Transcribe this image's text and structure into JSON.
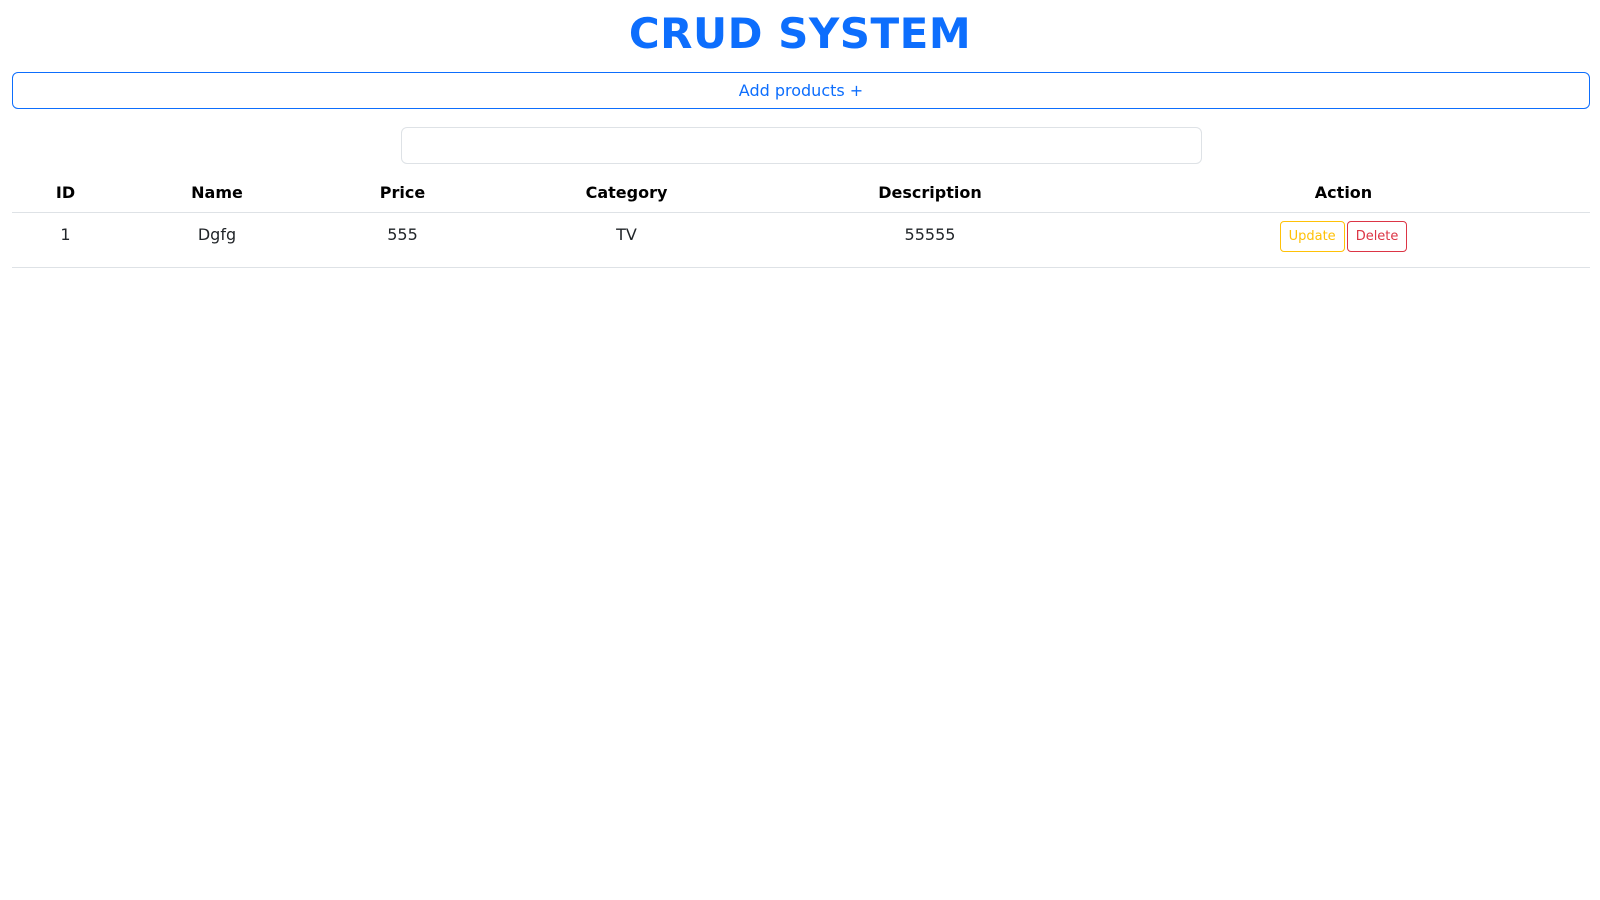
{
  "header": {
    "title": "CRUD SYSTEM"
  },
  "toolbar": {
    "add_label": "Add products +"
  },
  "search": {
    "value": "",
    "placeholder": ""
  },
  "table": {
    "columns": [
      "ID",
      "Name",
      "Price",
      "Category",
      "Description",
      "Action"
    ],
    "rows": [
      {
        "id": "1",
        "name": "Dgfg",
        "price": "555",
        "category": "TV",
        "description": "55555",
        "update_label": "Update",
        "delete_label": "Delete"
      }
    ]
  },
  "colors": {
    "primary": "#0d6efd",
    "warning": "#ffc107",
    "danger": "#dc3545"
  }
}
